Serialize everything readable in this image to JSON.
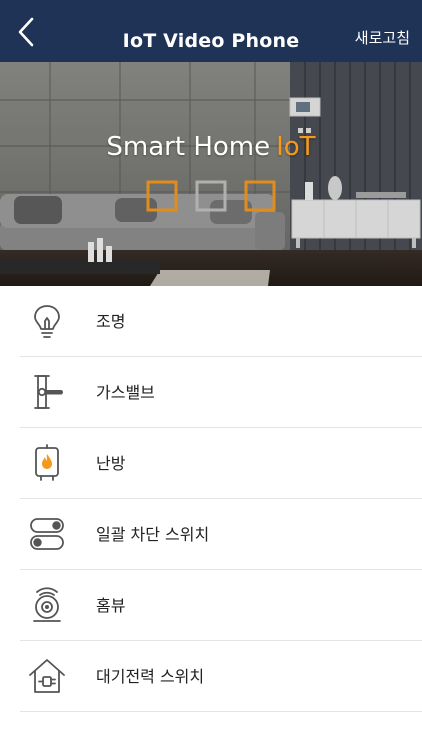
{
  "header": {
    "title": "IoT Video Phone",
    "refresh_label": "새로고침",
    "background_color": "#1f3357"
  },
  "banner": {
    "title": "Smart Home",
    "accent": "IoT",
    "accent_color": "#f39a1e"
  },
  "menu": {
    "items": [
      {
        "label": "조명",
        "icon": "light-bulb-icon"
      },
      {
        "label": "가스밸브",
        "icon": "gas-valve-icon"
      },
      {
        "label": "난방",
        "icon": "heating-icon"
      },
      {
        "label": "일괄 차단 스위치",
        "icon": "toggle-switch-icon"
      },
      {
        "label": "홈뷰",
        "icon": "camera-icon"
      },
      {
        "label": "대기전력 스위치",
        "icon": "standby-power-icon"
      }
    ]
  }
}
